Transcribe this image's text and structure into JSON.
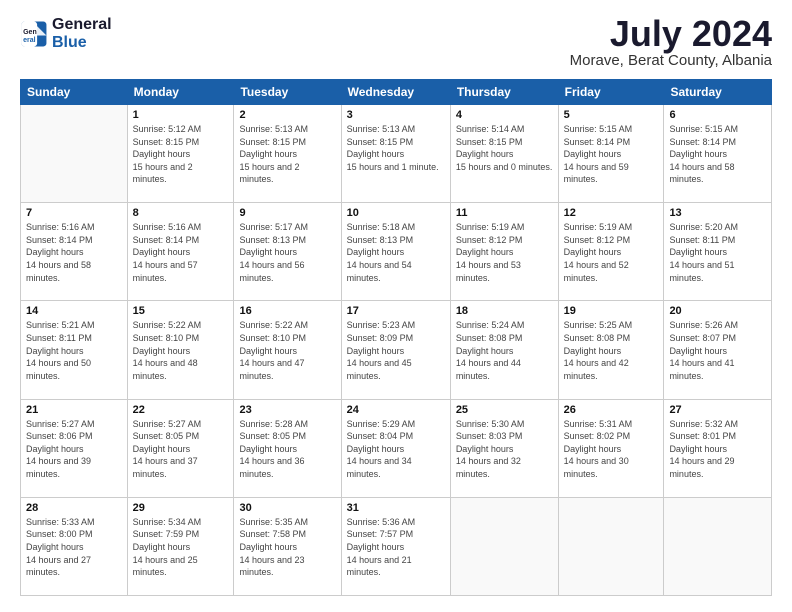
{
  "logo": {
    "line1": "General",
    "line2": "Blue"
  },
  "title": "July 2024",
  "subtitle": "Morave, Berat County, Albania",
  "weekdays": [
    "Sunday",
    "Monday",
    "Tuesday",
    "Wednesday",
    "Thursday",
    "Friday",
    "Saturday"
  ],
  "weeks": [
    [
      {
        "day": "",
        "empty": true
      },
      {
        "day": "1",
        "sunrise": "5:12 AM",
        "sunset": "8:15 PM",
        "daylight": "15 hours and 2 minutes."
      },
      {
        "day": "2",
        "sunrise": "5:13 AM",
        "sunset": "8:15 PM",
        "daylight": "15 hours and 2 minutes."
      },
      {
        "day": "3",
        "sunrise": "5:13 AM",
        "sunset": "8:15 PM",
        "daylight": "15 hours and 1 minute."
      },
      {
        "day": "4",
        "sunrise": "5:14 AM",
        "sunset": "8:15 PM",
        "daylight": "15 hours and 0 minutes."
      },
      {
        "day": "5",
        "sunrise": "5:15 AM",
        "sunset": "8:14 PM",
        "daylight": "14 hours and 59 minutes."
      },
      {
        "day": "6",
        "sunrise": "5:15 AM",
        "sunset": "8:14 PM",
        "daylight": "14 hours and 58 minutes."
      }
    ],
    [
      {
        "day": "7",
        "sunrise": "5:16 AM",
        "sunset": "8:14 PM",
        "daylight": "14 hours and 58 minutes."
      },
      {
        "day": "8",
        "sunrise": "5:16 AM",
        "sunset": "8:14 PM",
        "daylight": "14 hours and 57 minutes."
      },
      {
        "day": "9",
        "sunrise": "5:17 AM",
        "sunset": "8:13 PM",
        "daylight": "14 hours and 56 minutes."
      },
      {
        "day": "10",
        "sunrise": "5:18 AM",
        "sunset": "8:13 PM",
        "daylight": "14 hours and 54 minutes."
      },
      {
        "day": "11",
        "sunrise": "5:19 AM",
        "sunset": "8:12 PM",
        "daylight": "14 hours and 53 minutes."
      },
      {
        "day": "12",
        "sunrise": "5:19 AM",
        "sunset": "8:12 PM",
        "daylight": "14 hours and 52 minutes."
      },
      {
        "day": "13",
        "sunrise": "5:20 AM",
        "sunset": "8:11 PM",
        "daylight": "14 hours and 51 minutes."
      }
    ],
    [
      {
        "day": "14",
        "sunrise": "5:21 AM",
        "sunset": "8:11 PM",
        "daylight": "14 hours and 50 minutes."
      },
      {
        "day": "15",
        "sunrise": "5:22 AM",
        "sunset": "8:10 PM",
        "daylight": "14 hours and 48 minutes."
      },
      {
        "day": "16",
        "sunrise": "5:22 AM",
        "sunset": "8:10 PM",
        "daylight": "14 hours and 47 minutes."
      },
      {
        "day": "17",
        "sunrise": "5:23 AM",
        "sunset": "8:09 PM",
        "daylight": "14 hours and 45 minutes."
      },
      {
        "day": "18",
        "sunrise": "5:24 AM",
        "sunset": "8:08 PM",
        "daylight": "14 hours and 44 minutes."
      },
      {
        "day": "19",
        "sunrise": "5:25 AM",
        "sunset": "8:08 PM",
        "daylight": "14 hours and 42 minutes."
      },
      {
        "day": "20",
        "sunrise": "5:26 AM",
        "sunset": "8:07 PM",
        "daylight": "14 hours and 41 minutes."
      }
    ],
    [
      {
        "day": "21",
        "sunrise": "5:27 AM",
        "sunset": "8:06 PM",
        "daylight": "14 hours and 39 minutes."
      },
      {
        "day": "22",
        "sunrise": "5:27 AM",
        "sunset": "8:05 PM",
        "daylight": "14 hours and 37 minutes."
      },
      {
        "day": "23",
        "sunrise": "5:28 AM",
        "sunset": "8:05 PM",
        "daylight": "14 hours and 36 minutes."
      },
      {
        "day": "24",
        "sunrise": "5:29 AM",
        "sunset": "8:04 PM",
        "daylight": "14 hours and 34 minutes."
      },
      {
        "day": "25",
        "sunrise": "5:30 AM",
        "sunset": "8:03 PM",
        "daylight": "14 hours and 32 minutes."
      },
      {
        "day": "26",
        "sunrise": "5:31 AM",
        "sunset": "8:02 PM",
        "daylight": "14 hours and 30 minutes."
      },
      {
        "day": "27",
        "sunrise": "5:32 AM",
        "sunset": "8:01 PM",
        "daylight": "14 hours and 29 minutes."
      }
    ],
    [
      {
        "day": "28",
        "sunrise": "5:33 AM",
        "sunset": "8:00 PM",
        "daylight": "14 hours and 27 minutes."
      },
      {
        "day": "29",
        "sunrise": "5:34 AM",
        "sunset": "7:59 PM",
        "daylight": "14 hours and 25 minutes."
      },
      {
        "day": "30",
        "sunrise": "5:35 AM",
        "sunset": "7:58 PM",
        "daylight": "14 hours and 23 minutes."
      },
      {
        "day": "31",
        "sunrise": "5:36 AM",
        "sunset": "7:57 PM",
        "daylight": "14 hours and 21 minutes."
      },
      {
        "day": "",
        "empty": true
      },
      {
        "day": "",
        "empty": true
      },
      {
        "day": "",
        "empty": true
      }
    ]
  ],
  "labels": {
    "sunrise": "Sunrise:",
    "sunset": "Sunset:",
    "daylight": "Daylight hours"
  }
}
